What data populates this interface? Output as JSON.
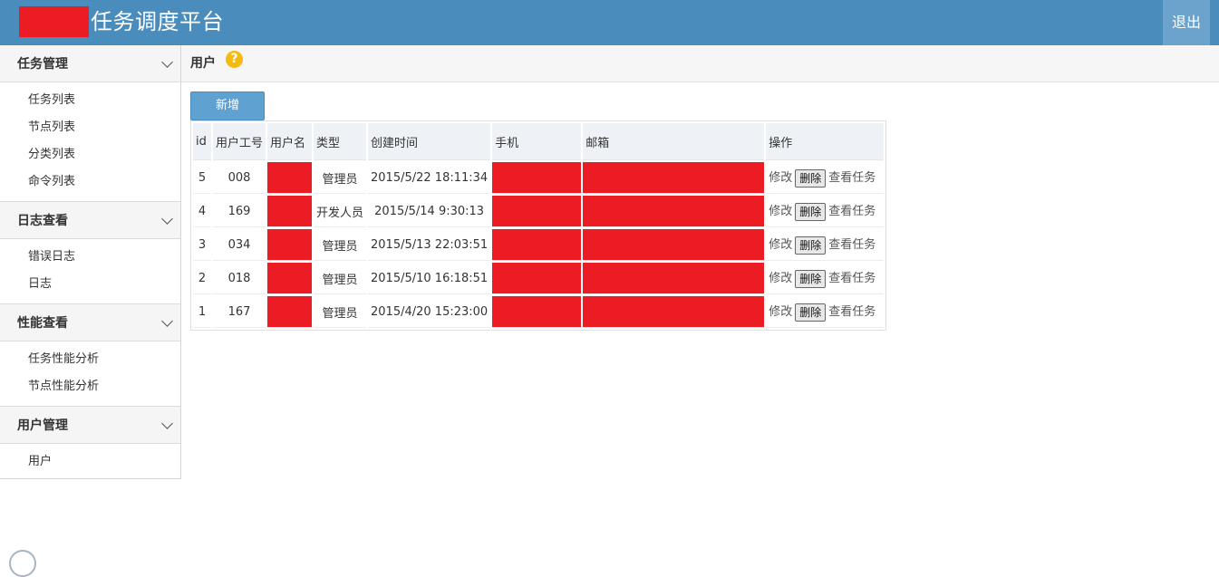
{
  "header": {
    "title": "任务调度平台",
    "logout_label": "退出"
  },
  "sidebar": {
    "groups": [
      {
        "title": "任务管理",
        "items": [
          "任务列表",
          "节点列表",
          "分类列表",
          "命令列表"
        ]
      },
      {
        "title": "日志查看",
        "items": [
          "错误日志",
          "日志"
        ]
      },
      {
        "title": "性能查看",
        "items": [
          "任务性能分析",
          "节点性能分析"
        ]
      },
      {
        "title": "用户管理",
        "items": [
          "用户"
        ]
      }
    ]
  },
  "main": {
    "title": "用户",
    "help_icon": "question-circle-icon",
    "add_label": "新增",
    "table": {
      "headers": [
        "id",
        "用户工号",
        "用户名",
        "类型",
        "创建时间",
        "手机",
        "邮箱",
        "操作"
      ],
      "rows": [
        {
          "id": "5",
          "job_no": "008",
          "type": "管理员",
          "created": "2015/5/22 18:11:34"
        },
        {
          "id": "4",
          "job_no": "169",
          "type": "开发人员",
          "created": "2015/5/14 9:30:13"
        },
        {
          "id": "3",
          "job_no": "034",
          "type": "管理员",
          "created": "2015/5/13 22:03:51"
        },
        {
          "id": "2",
          "job_no": "018",
          "type": "管理员",
          "created": "2015/5/10 16:18:51"
        },
        {
          "id": "1",
          "job_no": "167",
          "type": "管理员",
          "created": "2015/4/20 15:23:00"
        }
      ],
      "actions": {
        "edit": "修改",
        "delete": "删除",
        "view_tasks": "查看任务"
      }
    }
  },
  "colors": {
    "header_bg": "#4a8dbd",
    "redaction": "#ec1c24",
    "help_icon": "#f5b90f"
  }
}
